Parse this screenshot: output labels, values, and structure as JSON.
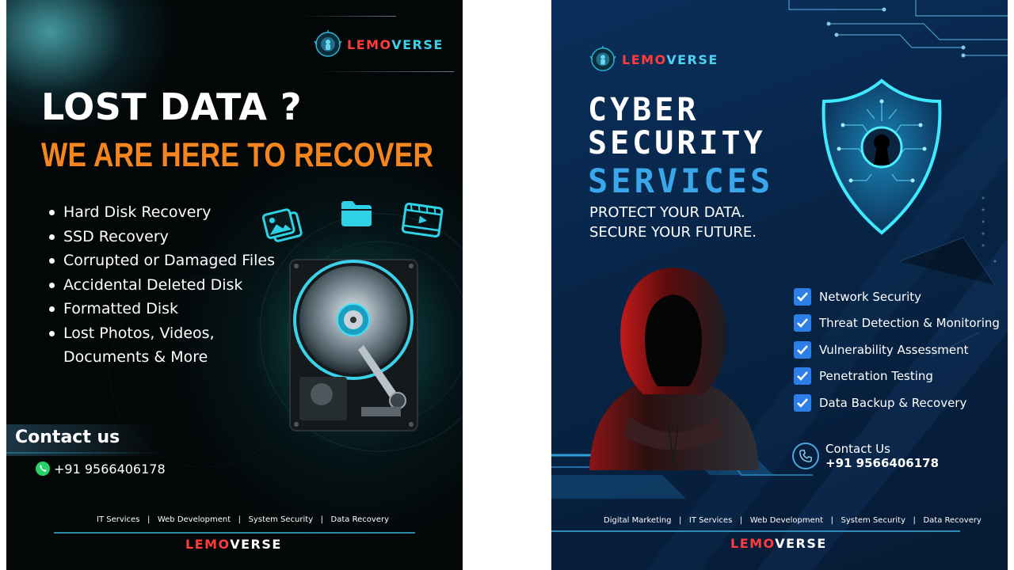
{
  "left_poster": {
    "brand": {
      "part1": "LEMO",
      "part2": "VERSE"
    },
    "title": "LOST DATA ?",
    "subtitle": "WE ARE HERE TO RECOVER",
    "services": [
      "Hard Disk Recovery",
      "SSD Recovery",
      "Corrupted or Damaged Files",
      "Accidental Deleted Disk",
      "Formatted Disk",
      "Lost Photos, Videos, Documents & More"
    ],
    "contact_title": "Contact us",
    "phone": "+91 9566406178",
    "footer_services": "IT Services   |   Web Development   |   System Security   |   Data Recovery",
    "footer_brand": {
      "part1": "LEMO",
      "part2": "VERSE"
    },
    "icons": [
      "logo-emblem-icon",
      "photos-icon",
      "folder-icon",
      "video-icon",
      "hard-disk-icon",
      "whatsapp-icon"
    ],
    "colors": {
      "accent": "#f5861f",
      "brand_red": "#ff3b3b",
      "glow": "#27c8e0"
    }
  },
  "right_poster": {
    "brand": {
      "part1": "LEMO",
      "part2": "VERSE"
    },
    "title_line1": "CYBER",
    "title_line2": "SECURITY",
    "title_line3": "SERVICES",
    "tagline_line1": "PROTECT YOUR DATA.",
    "tagline_line2": "SECURE YOUR FUTURE.",
    "services": [
      "Network Security",
      "Threat Detection & Monitoring",
      "Vulnerability Assessment",
      "Penetration Testing",
      "Data Backup & Recovery"
    ],
    "contact_title": "Contact Us",
    "phone": "+91 9566406178",
    "footer_services": "Digital Marketing   |   IT Services   |   Web Development   |   System Security   |   Data Recovery",
    "footer_brand": {
      "part1": "LEMO",
      "part2": "VERSE"
    },
    "icons": [
      "logo-emblem-icon",
      "shield-lock-icon",
      "hooded-hacker-figure",
      "checkbox-icon",
      "phone-icon",
      "circuit-lines"
    ],
    "colors": {
      "background": "#082446",
      "accent_blue": "#3aa7ea",
      "brand_red": "#ff3b3b",
      "cyan": "#4fe0f5"
    }
  }
}
